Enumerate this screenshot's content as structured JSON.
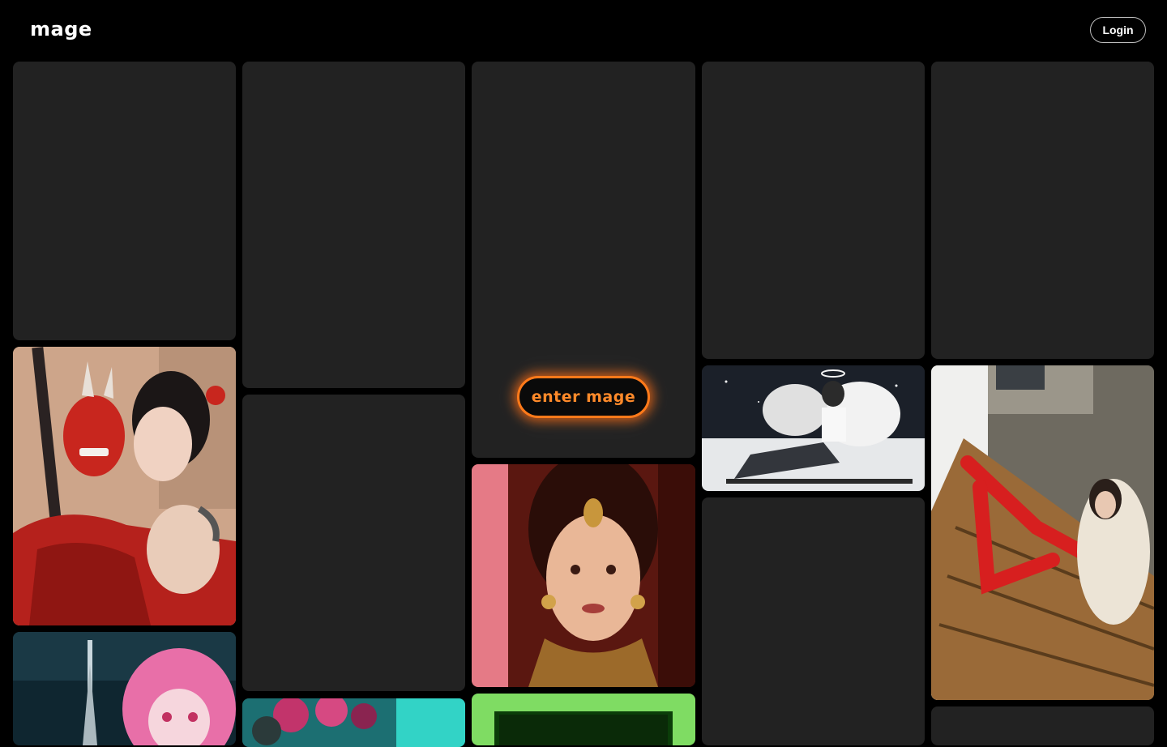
{
  "header": {
    "logo": "mage",
    "login_label": "Login"
  },
  "hero": {
    "enter_label": "enter mage"
  },
  "gallery": {
    "images": [
      "oni-mask-geisha-image",
      "indian-bride-portrait-image",
      "angel-boy-image",
      "red-tights-stairs-image",
      "pink-hair-anime-rain-image",
      "pink-flowers-teal-image",
      "green-frame-image"
    ]
  },
  "colors": {
    "background": "#000000",
    "card": "#222222",
    "accent": "#ff7a1a"
  }
}
